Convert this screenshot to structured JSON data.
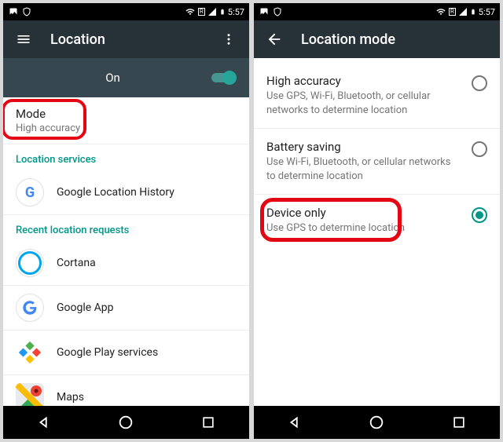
{
  "status": {
    "time": "5:57",
    "r_badge": "R"
  },
  "left": {
    "title": "Location",
    "toggle": "On",
    "mode": {
      "title": "Mode",
      "sub": "High accuracy"
    },
    "svc_header": "Location services",
    "svc_history": "Google Location History",
    "recent_header": "Recent location requests",
    "apps": {
      "cortana": "Cortana",
      "gapp": "Google App",
      "gplay": "Google Play services",
      "gmaps": "Maps"
    }
  },
  "right": {
    "title": "Location mode",
    "options": {
      "high": {
        "title": "High accuracy",
        "sub": "Use GPS, Wi-Fi, Bluetooth, or cellular networks to determine location"
      },
      "batt": {
        "title": "Battery saving",
        "sub": "Use Wi-Fi, Bluetooth, or cellular networks to determine location"
      },
      "dev": {
        "title": "Device only",
        "sub": "Use GPS to determine location"
      }
    }
  }
}
